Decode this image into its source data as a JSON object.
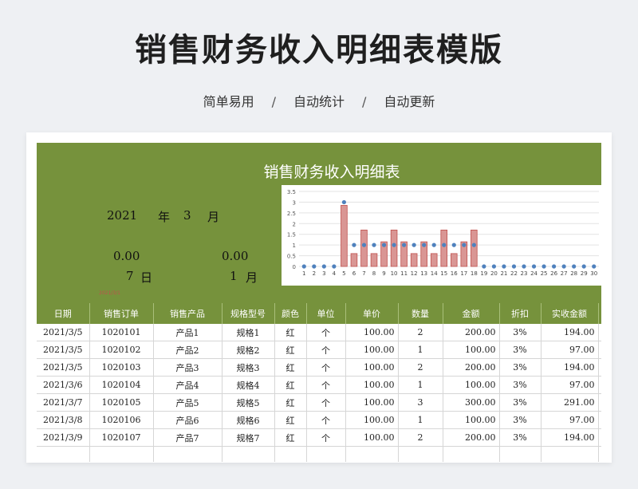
{
  "page": {
    "title": "销售财务收入明细表模版",
    "tags": [
      "简单易用",
      "自动统计",
      "自动更新"
    ],
    "separator": "/"
  },
  "sheet": {
    "title": "销售财务收入明细表",
    "year": "2021",
    "year_unit": "年",
    "month": "3",
    "month_unit": "月",
    "stat_left": "0.00",
    "stat_right": "0.00",
    "days_left": "7",
    "days_left_unit": "日",
    "days_right": "1",
    "days_right_unit": "月",
    "tiny_mark": "2021/3/1"
  },
  "table": {
    "headers": [
      "日期",
      "销售订单",
      "销售产品",
      "规格型号",
      "颜色",
      "单位",
      "单价",
      "数量",
      "金额",
      "折扣",
      "实收金额",
      ""
    ],
    "rows": [
      [
        "2021/3/5",
        "1020101",
        "产品1",
        "规格1",
        "红",
        "个",
        "100.00",
        "2",
        "200.00",
        "3%",
        "194.00"
      ],
      [
        "2021/3/5",
        "1020102",
        "产品2",
        "规格2",
        "红",
        "个",
        "100.00",
        "1",
        "100.00",
        "3%",
        "97.00"
      ],
      [
        "2021/3/5",
        "1020103",
        "产品3",
        "规格3",
        "红",
        "个",
        "100.00",
        "2",
        "200.00",
        "3%",
        "194.00"
      ],
      [
        "2021/3/6",
        "1020104",
        "产品4",
        "规格4",
        "红",
        "个",
        "100.00",
        "1",
        "100.00",
        "3%",
        "97.00"
      ],
      [
        "2021/3/7",
        "1020105",
        "产品5",
        "规格5",
        "红",
        "个",
        "100.00",
        "3",
        "300.00",
        "3%",
        "291.00"
      ],
      [
        "2021/3/8",
        "1020106",
        "产品6",
        "规格6",
        "红",
        "个",
        "100.00",
        "1",
        "100.00",
        "3%",
        "97.00"
      ],
      [
        "2021/3/9",
        "1020107",
        "产品7",
        "规格7",
        "红",
        "个",
        "100.00",
        "2",
        "200.00",
        "3%",
        "194.00"
      ],
      [
        "",
        "",
        "",
        "",
        "",
        "",
        "",
        "",
        "",
        "",
        ""
      ]
    ]
  },
  "chart_data": {
    "type": "bar",
    "categories": [
      "1",
      "2",
      "3",
      "4",
      "5",
      "6",
      "7",
      "8",
      "9",
      "10",
      "11",
      "12",
      "13",
      "14",
      "15",
      "16",
      "17",
      "18",
      "19",
      "20",
      "21",
      "22",
      "23",
      "24",
      "25",
      "26",
      "27",
      "28",
      "29",
      "30"
    ],
    "series": [
      {
        "values": [
          0,
          0,
          0,
          0,
          2.85,
          0.6,
          1.7,
          0.6,
          1.15,
          1.7,
          1.15,
          0.6,
          1.15,
          0.6,
          1.7,
          0.6,
          1.15,
          1.7,
          0,
          0,
          0,
          0,
          0,
          0,
          0,
          0,
          0,
          0,
          0,
          0
        ]
      },
      {
        "values": [
          0,
          0,
          0,
          0,
          3,
          1,
          1,
          1,
          1,
          1,
          1,
          1,
          1,
          1,
          1,
          1,
          1,
          1,
          0,
          0,
          0,
          0,
          0,
          0,
          0,
          0,
          0,
          0,
          0,
          0
        ]
      }
    ],
    "ylim": [
      0,
      3.5
    ],
    "yticks": [
      "0",
      "0.5",
      "1",
      "1.5",
      "2",
      "2.5",
      "3",
      "3.5"
    ],
    "colors": {
      "bar": "#d99694",
      "bar_border": "#c0504d",
      "point": "#4f81bd",
      "grid": "#e3e3e3",
      "banner": "#76923c"
    }
  }
}
